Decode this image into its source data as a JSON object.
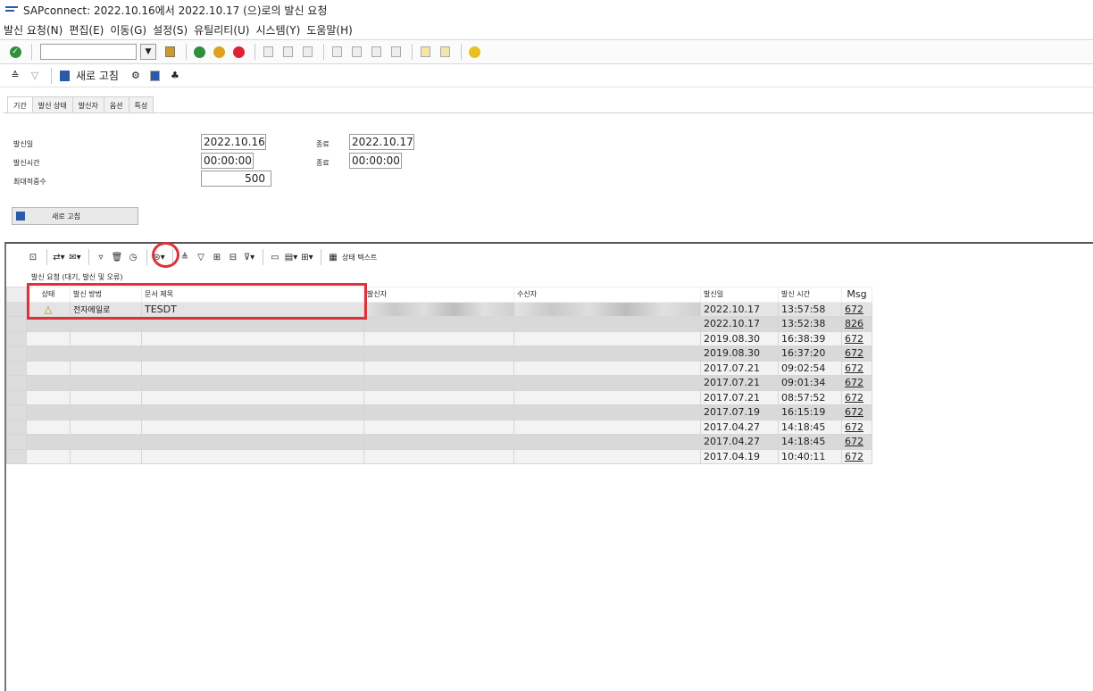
{
  "window": {
    "title": "SAPconnect: 2022.10.16에서 2022.10.17   (으)로의 발신 요청"
  },
  "menu": [
    "발신 요청(N)",
    "편집(E)",
    "이동(G)",
    "설정(S)",
    "유틸리티(U)",
    "시스템(Y)",
    "도움말(H)"
  ],
  "toolbar2": {
    "refresh_label": "새로 고침"
  },
  "tabs": [
    "기간",
    "발신 상태",
    "발신자",
    "옵션",
    "특성"
  ],
  "form": {
    "send_date_label": "발신일",
    "send_date_from": "2022.10.16",
    "end_label_1": "종료",
    "send_date_to": "2022.10.17",
    "send_time_label": "발신시간",
    "send_time_from": "00:00:00",
    "end_label_2": "종료",
    "send_time_to": "00:00:00",
    "max_hits_label": "최대적중수",
    "max_hits": "500",
    "refresh_button": "새로 고침"
  },
  "grid_toolbar": {
    "status_text_label": "상태 텍스트"
  },
  "grid": {
    "title": "발신 요청 (대기, 발신 및 오류)",
    "headers": {
      "status": "상태",
      "method": "발신 방법",
      "doc_title": "문서 제목",
      "sender": "발신자",
      "recipient": "수신자",
      "date": "발신일",
      "time": "발신 시간",
      "msg": "Msg"
    },
    "rows": [
      {
        "method": "전자메일로",
        "title": "TESDT",
        "date": "2022.10.17",
        "time": "13:57:58",
        "msg": "672"
      },
      {
        "method": "",
        "title": "",
        "date": "2022.10.17",
        "time": "13:52:38",
        "msg": "826"
      },
      {
        "method": "",
        "title": "",
        "date": "2019.08.30",
        "time": "16:38:39",
        "msg": "672"
      },
      {
        "method": "",
        "title": "",
        "date": "2019.08.30",
        "time": "16:37:20",
        "msg": "672"
      },
      {
        "method": "",
        "title": "",
        "date": "2017.07.21",
        "time": "09:02:54",
        "msg": "672"
      },
      {
        "method": "",
        "title": "",
        "date": "2017.07.21",
        "time": "09:01:34",
        "msg": "672"
      },
      {
        "method": "",
        "title": "",
        "date": "2017.07.21",
        "time": "08:57:52",
        "msg": "672"
      },
      {
        "method": "",
        "title": "",
        "date": "2017.07.19",
        "time": "16:15:19",
        "msg": "672"
      },
      {
        "method": "",
        "title": "",
        "date": "2017.04.27",
        "time": "14:18:45",
        "msg": "672"
      },
      {
        "method": "",
        "title": "",
        "date": "2017.04.27",
        "time": "14:18:45",
        "msg": "672"
      },
      {
        "method": "",
        "title": "",
        "date": "2017.04.19",
        "time": "10:40:11",
        "msg": "672"
      }
    ]
  },
  "icons": {
    "status_warning": "warning-triangle-icon"
  },
  "colors": {
    "highlight": "#e0303a",
    "sap_blue": "#2b5ba8"
  }
}
